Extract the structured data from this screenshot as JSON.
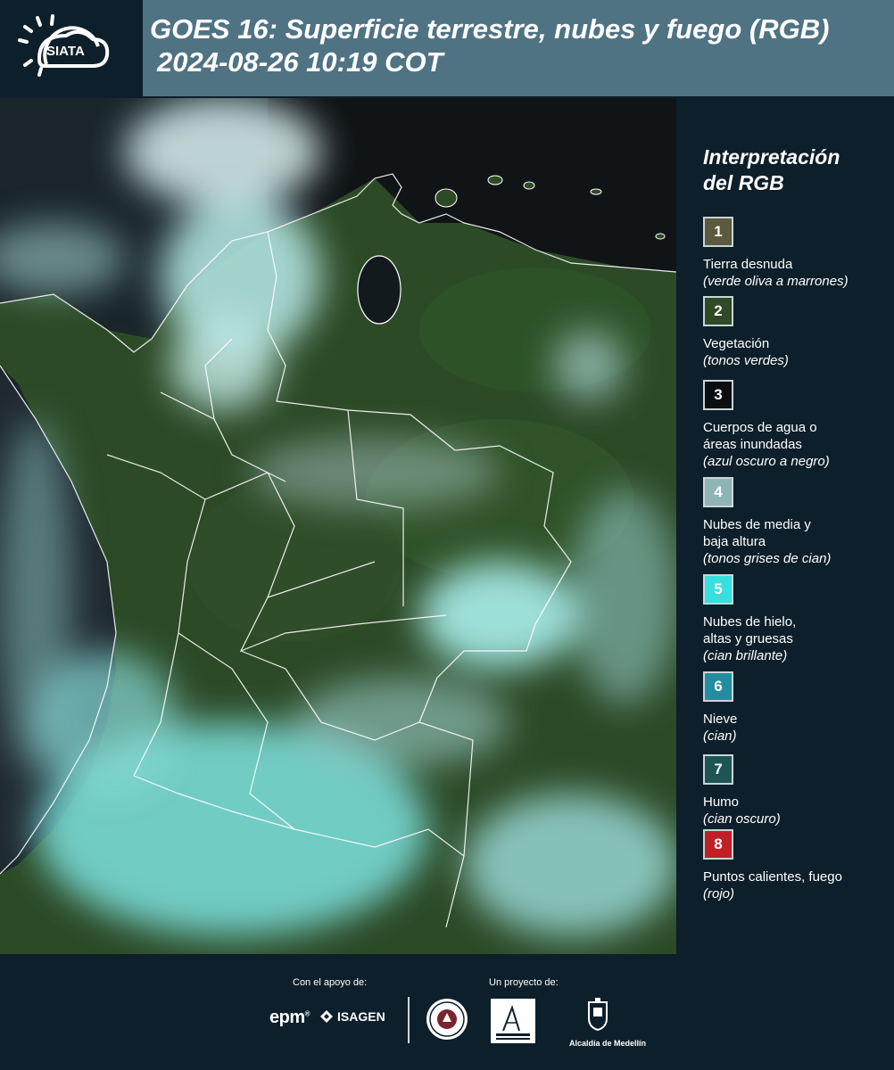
{
  "header": {
    "logo_text": "SIATA",
    "title_line1": "GOES 16: Superficie terrestre, nubes y fuego (RGB)",
    "title_line2": "2024-08-26 10:19 COT"
  },
  "legend": {
    "title_line1": "Interpretación",
    "title_line2": "del RGB",
    "items": [
      {
        "number": "1",
        "label_line1": "Tierra desnuda",
        "label_line2": "",
        "note": "(verde oliva a marrones)",
        "color": "#5b5a3f"
      },
      {
        "number": "2",
        "label_line1": "Vegetación",
        "label_line2": "",
        "note": "(tonos verdes)",
        "color": "#2f4a25"
      },
      {
        "number": "3",
        "label_line1": "Cuerpos de agua o",
        "label_line2": "áreas inundadas",
        "note": "(azul oscuro a negro)",
        "color": "#0b0d10"
      },
      {
        "number": "4",
        "label_line1": "Nubes de media y",
        "label_line2": "baja altura",
        "note": "(tonos grises de cian)",
        "color": "#8fb4b5"
      },
      {
        "number": "5",
        "label_line1": "Nubes de hielo,",
        "label_line2": "altas y gruesas",
        "note": "(cian brillante)",
        "color": "#36e0de"
      },
      {
        "number": "6",
        "label_line1": "Nieve",
        "label_line2": "",
        "note": "(cian)",
        "color": "#228da0"
      },
      {
        "number": "7",
        "label_line1": "Humo",
        "label_line2": "",
        "note": "(cian oscuro)",
        "color": "#1d5454"
      },
      {
        "number": "8",
        "label_line1": "Puntos calientes, fuego",
        "label_line2": "",
        "note": "(rojo)",
        "color": "#c11f26"
      }
    ]
  },
  "footer": {
    "support_label": "Con el apoyo de:",
    "project_label": "Un proyecto de:",
    "epm": "epm",
    "isagen": "ISAGEN",
    "area_logo": "Área METROPOLITANA Valle de Aburrá",
    "alcaldia": "Alcaldía de Medellín"
  }
}
